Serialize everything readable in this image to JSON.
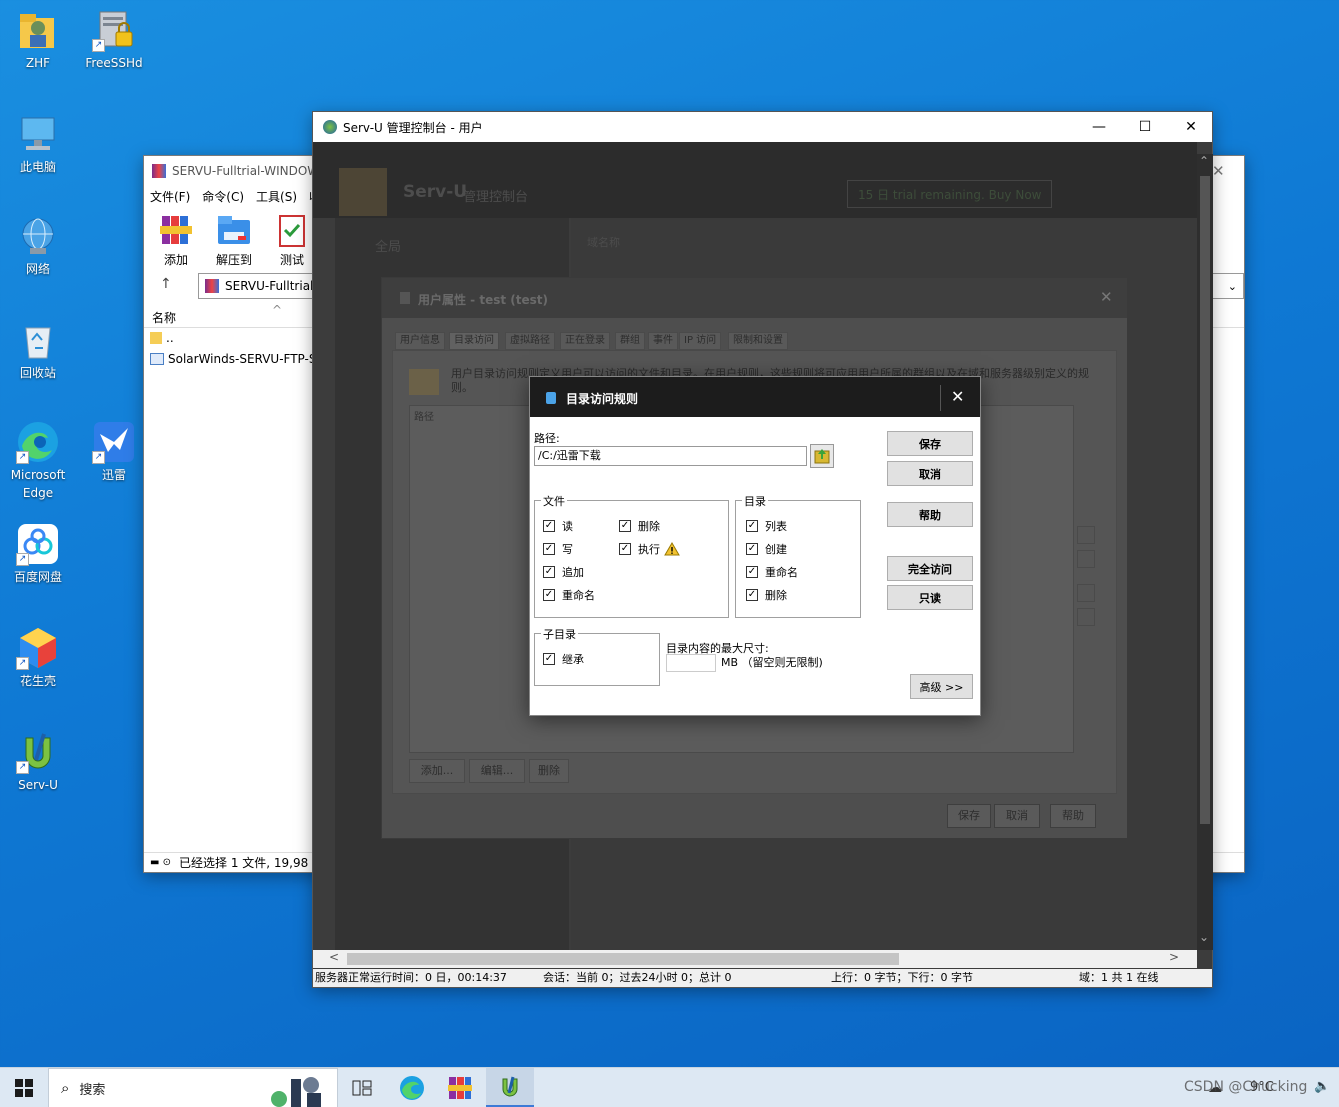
{
  "desktop_icons": [
    {
      "label": "ZHF",
      "icon": "user-folder-icon"
    },
    {
      "label": "FreeSSHd",
      "icon": "server-lock-icon"
    },
    {
      "label": "此电脑",
      "icon": "computer-icon"
    },
    {
      "label": "网络",
      "icon": "network-globe-icon"
    },
    {
      "label": "回收站",
      "icon": "recycle-bin-icon"
    },
    {
      "label": "Microsoft Edge",
      "icon": "edge-icon"
    },
    {
      "label": "迅雷",
      "icon": "thunder-bird-icon"
    },
    {
      "label": "百度网盘",
      "icon": "baidu-netdisk-icon"
    },
    {
      "label": "花生壳",
      "icon": "peanut-shell-icon"
    },
    {
      "label": "Serv-U",
      "icon": "servu-icon"
    }
  ],
  "winrar": {
    "title": "SERVU-Fulltrial-WINDOW",
    "menu": [
      "文件(F)",
      "命令(C)",
      "工具(S)",
      "收"
    ],
    "toolbar": [
      "添加",
      "解压到",
      "测试"
    ],
    "path": "SERVU-Fulltrial-",
    "column_name": "名称",
    "files": [
      "..",
      "SolarWinds-SERVU-FTP-S"
    ],
    "status": "已经选择 1 文件, 19,98"
  },
  "servu": {
    "title": "Serv-U 管理控制台 - 用户",
    "bg_brand": "Serv-U",
    "bg_brand_sub": "管理控制台",
    "bg_trial": "15 日 trial remaining. Buy Now",
    "bg_nav_global": "全局",
    "bg_domain": "域名称",
    "status": [
      "服务器正常运行时间：0 日，00:14:37",
      "会话：当前 0；过去24小时 0；总计 0",
      "上行：0 字节；下行：0 字节",
      "域：1 共 1 在线"
    ]
  },
  "user_props": {
    "title": "用户属性 - test (test)",
    "tabs": [
      "用户信息",
      "目录访问",
      "虚拟路径",
      "正在登录",
      "群组",
      "事件",
      "IP 访问",
      "限制和设置"
    ],
    "description": "用户目录访问规则定义用户可以访问的文件和目录。在用户规则，这些规则将可应用用户所属的群组以及在域和服务器级别定义的规则。",
    "column_path": "路径",
    "buttons": [
      "添加...",
      "编辑...",
      "删除"
    ],
    "footer_buttons": [
      "保存",
      "取消",
      "帮助"
    ]
  },
  "dialog": {
    "title": "目录访问规则",
    "path_label": "路径:",
    "path_value": "/C:/迅雷下载",
    "files_group": "文件",
    "files": [
      {
        "label": "读",
        "checked": true
      },
      {
        "label": "写",
        "checked": true
      },
      {
        "label": "追加",
        "checked": true
      },
      {
        "label": "重命名",
        "checked": true
      },
      {
        "label": "删除",
        "checked": true
      },
      {
        "label": "执行",
        "checked": true
      }
    ],
    "dirs_group": "目录",
    "dirs": [
      {
        "label": "列表",
        "checked": true
      },
      {
        "label": "创建",
        "checked": true
      },
      {
        "label": "重命名",
        "checked": true
      },
      {
        "label": "删除",
        "checked": true
      }
    ],
    "subdir_group": "子目录",
    "subdir": [
      {
        "label": "继承",
        "checked": true
      }
    ],
    "max_size_label": "目录内容的最大尺寸:",
    "max_size_value": "",
    "max_size_unit": "MB （留空则无限制)",
    "buttons": {
      "save": "保存",
      "cancel": "取消",
      "help": "帮助",
      "full": "完全访问",
      "readonly": "只读",
      "advanced": "高级 >>"
    },
    "close": "✕"
  },
  "taskbar": {
    "search": "搜索",
    "watermark": "CSDN @Chucking",
    "weather": "9°C"
  }
}
